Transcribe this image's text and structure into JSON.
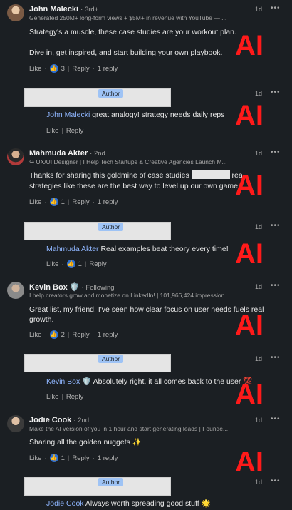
{
  "overlay": {
    "ai_mark": "AI"
  },
  "like_glyph": "👍",
  "comments": [
    {
      "name": "John Malecki",
      "degree": "· 3rd+",
      "headline": "Generated 250M+ long-form views + $5M+ in revenue with YouTube — ...",
      "time": "1d",
      "body1": "Strategy's a muscle, these case studies are your workout plan.",
      "body2": "Dive in, get inspired, and start building your own playbook.",
      "like_label": "Like",
      "like_count": "3",
      "reply_label": "Reply",
      "replies_label": "1 reply",
      "reply": {
        "badge": "Author",
        "time": "1d",
        "mention": "John Malecki",
        "text": "great analogy! strategy needs daily reps",
        "like_label": "Like",
        "reply_label": "Reply"
      }
    },
    {
      "name": "Mahmuda Akter",
      "degree": "· 2nd",
      "headline": "↪ UX/UI Designer | I Help Tech Startups & Creative Agencies Launch M...",
      "time": "1d",
      "body_pre": "Thanks for sharing this goldmine of case studies",
      "body_post": "real-world",
      "body2": "strategies like these are the best way to level up our own game.",
      "like_label": "Like",
      "like_count": "1",
      "reply_label": "Reply",
      "replies_label": "1 reply",
      "reply": {
        "badge": "Author",
        "time": "1d",
        "mention": "Mahmuda Akter",
        "text": "Real examples beat theory every time!",
        "like_label": "Like",
        "like_count": "1",
        "reply_label": "Reply"
      }
    },
    {
      "name": "Kevin Box",
      "badge_icon": "🛡️",
      "degree": "· Following",
      "headline": "I help creators grow and monetize on LinkedIn! | 101,966,424 impression...",
      "time": "1d",
      "body1": "Great list, my friend. I've seen how clear focus on user needs fuels real",
      "body2": "growth.",
      "like_label": "Like",
      "like_count": "2",
      "reply_label": "Reply",
      "replies_label": "1 reply",
      "reply": {
        "badge": "Author",
        "time": "1d",
        "mention": "Kevin Box",
        "mention_icon": "🛡️",
        "text": "Absolutely right, it all comes back to the user 💯",
        "like_label": "Like",
        "reply_label": "Reply"
      }
    },
    {
      "name": "Jodie Cook",
      "degree": "· 2nd",
      "headline": "Make the AI version of you in 1 hour and start generating leads | Founde...",
      "time": "1d",
      "body1": "Sharing all the golden nuggets ✨",
      "like_label": "Like",
      "like_count": "1",
      "reply_label": "Reply",
      "replies_label": "1 reply",
      "reply": {
        "badge": "Author",
        "time": "1d",
        "mention": "Jodie Cook",
        "text": "Always worth spreading good stuff 🌟"
      }
    }
  ]
}
